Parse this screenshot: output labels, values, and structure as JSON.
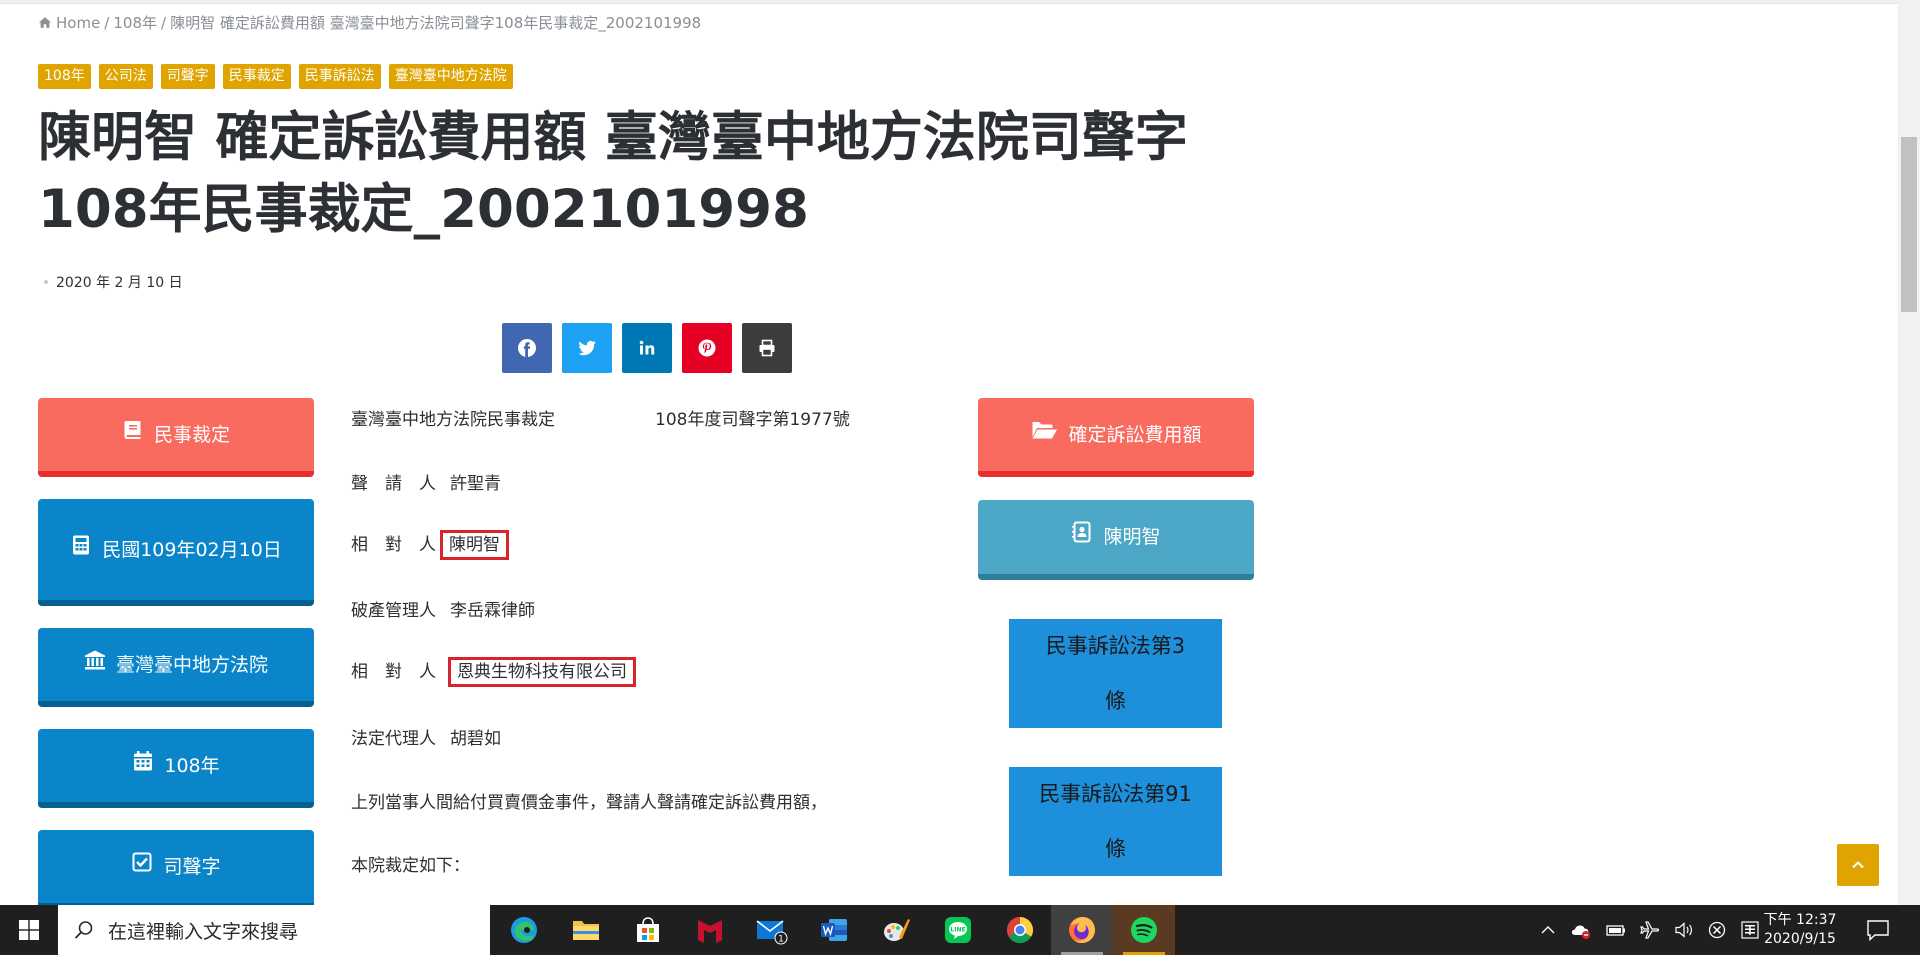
{
  "breadcrumb": {
    "home": "Home",
    "items": [
      "108年",
      "陳明智 確定訴訟費用額 臺灣臺中地方法院司聲字108年民事裁定_2002101998"
    ]
  },
  "tags": [
    "108年",
    "公司法",
    "司聲字",
    "民事裁定",
    "民事訴訟法",
    "臺灣臺中地方法院"
  ],
  "title": "陳明智 確定訴訟費用額 臺灣臺中地方法院司聲字108年民事裁定_2002101998",
  "date": "2020 年 2 月 10 日",
  "share": {
    "colors": {
      "facebook": "#4267b2",
      "twitter": "#1da1f2",
      "linkedin": "#0077b5",
      "pinterest": "#e60023",
      "print": "#3c3c3c"
    },
    "icons": [
      "facebook-icon",
      "twitter-icon",
      "linkedin-icon",
      "pinterest-icon",
      "print-icon"
    ]
  },
  "left_buttons": [
    {
      "label": "民事裁定",
      "icon": "book-icon",
      "color": "red"
    },
    {
      "label": "民國109年02月10日",
      "icon": "calculator-icon",
      "color": "blue"
    },
    {
      "label": "臺灣臺中地方法院",
      "icon": "courthouse-icon",
      "color": "blue"
    },
    {
      "label": "108年",
      "icon": "calendar-icon",
      "color": "blue"
    },
    {
      "label": "司聲字",
      "icon": "checkbox-icon",
      "color": "blue"
    }
  ],
  "article": {
    "court": "臺灣臺中地方法院民事裁定",
    "case_no": "108年度司聲字第1977號",
    "rows": [
      {
        "role": "聲　請　人",
        "name": "許聖青",
        "highlight": false
      },
      {
        "role": "相　對　人",
        "name": "陳明智",
        "highlight": true
      },
      {
        "role": "破產管理人",
        "name": "李岳霖律師",
        "highlight": false
      },
      {
        "role": "相　對　人",
        "name": "恩典生物科技有限公司",
        "highlight": true
      },
      {
        "role": "法定代理人",
        "name": "胡碧如",
        "highlight": false
      }
    ],
    "para1": "上列當事人間給付買賣價金事件，聲請人聲請確定訴訟費用額，",
    "para2": "本院裁定如下："
  },
  "right_buttons": [
    {
      "label": "確定訴訟費用額",
      "icon": "folder-open-icon",
      "color": "red"
    },
    {
      "label": "陳明智",
      "icon": "contact-book-icon",
      "color": "teal"
    }
  ],
  "laws": [
    {
      "line1": "民事訴訟法第3",
      "line2": "條"
    },
    {
      "line1": "民事訴訟法第91",
      "line2": "條"
    }
  ],
  "taskbar": {
    "search_placeholder": "在這裡輸入文字來搜尋",
    "mail_badge": "1",
    "time": "下午 12:37",
    "date": "2020/9/15"
  }
}
